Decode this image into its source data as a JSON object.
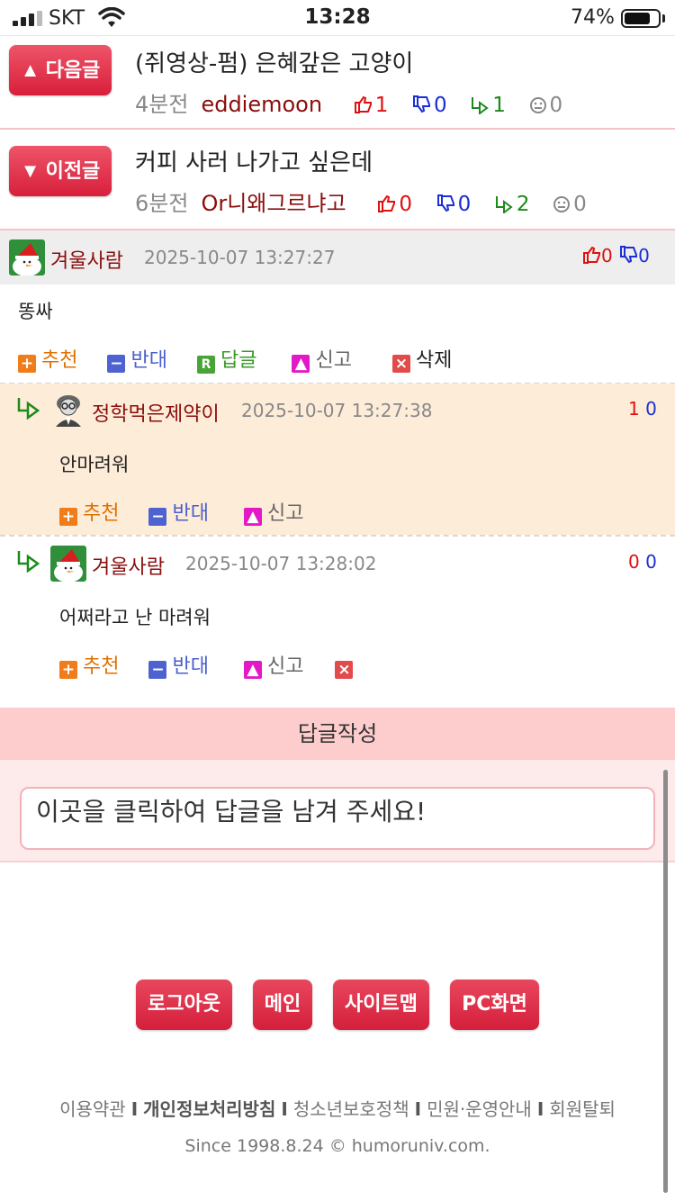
{
  "status_bar": {
    "carrier": "SKT",
    "time": "13:28",
    "battery": "74%"
  },
  "nav": {
    "next": {
      "button": "▲ 다음글",
      "title": "(쥐영상-펌) 은혜갚은 고양이",
      "time": "4분전",
      "author": "eddiemoon",
      "up": "1",
      "down": "0",
      "reply": "1",
      "emo": "0"
    },
    "prev": {
      "button": "▼ 이전글",
      "title": "커피 사러 나가고 싶은데",
      "time": "6분전",
      "author": "Or니왜그르냐고",
      "up": "0",
      "down": "0",
      "reply": "2",
      "emo": "0"
    }
  },
  "comments": [
    {
      "name": "겨울사람",
      "date": "2025-10-07 13:27:27",
      "up": "0",
      "down": "0",
      "body": "똥싸",
      "actions": {
        "recommend": "추천",
        "oppose": "반대",
        "reply": "답글",
        "report": "신고",
        "delete": "삭제"
      }
    },
    {
      "name": "정학먹은제약이",
      "date": "2025-10-07 13:27:38",
      "up": "1",
      "down": "0",
      "body": "안마려워",
      "actions": {
        "recommend": "추천",
        "oppose": "반대",
        "report": "신고"
      }
    },
    {
      "name": "겨울사람",
      "date": "2025-10-07 13:28:02",
      "up": "0",
      "down": "0",
      "body": "어쩌라고 난 마려워",
      "actions": {
        "recommend": "추천",
        "oppose": "반대",
        "report": "신고"
      }
    }
  ],
  "reply_form": {
    "header": "답글작성",
    "placeholder": "이곳을 클릭하여 답글을 남겨 주세요!"
  },
  "footer": {
    "buttons": [
      "로그아웃",
      "메인",
      "사이트맵",
      "PC화면"
    ],
    "links": [
      "이용약관",
      "개인정보처리방침",
      "청소년보호정책",
      "민원·운영안내",
      "회원탈퇴"
    ],
    "copyright": "Since 1998.8.24  © humoruniv.com."
  },
  "colors": {
    "accent_red": "#d81f3c",
    "reply_bg": "#fdecd8",
    "form_bg": "#fdeaea"
  }
}
